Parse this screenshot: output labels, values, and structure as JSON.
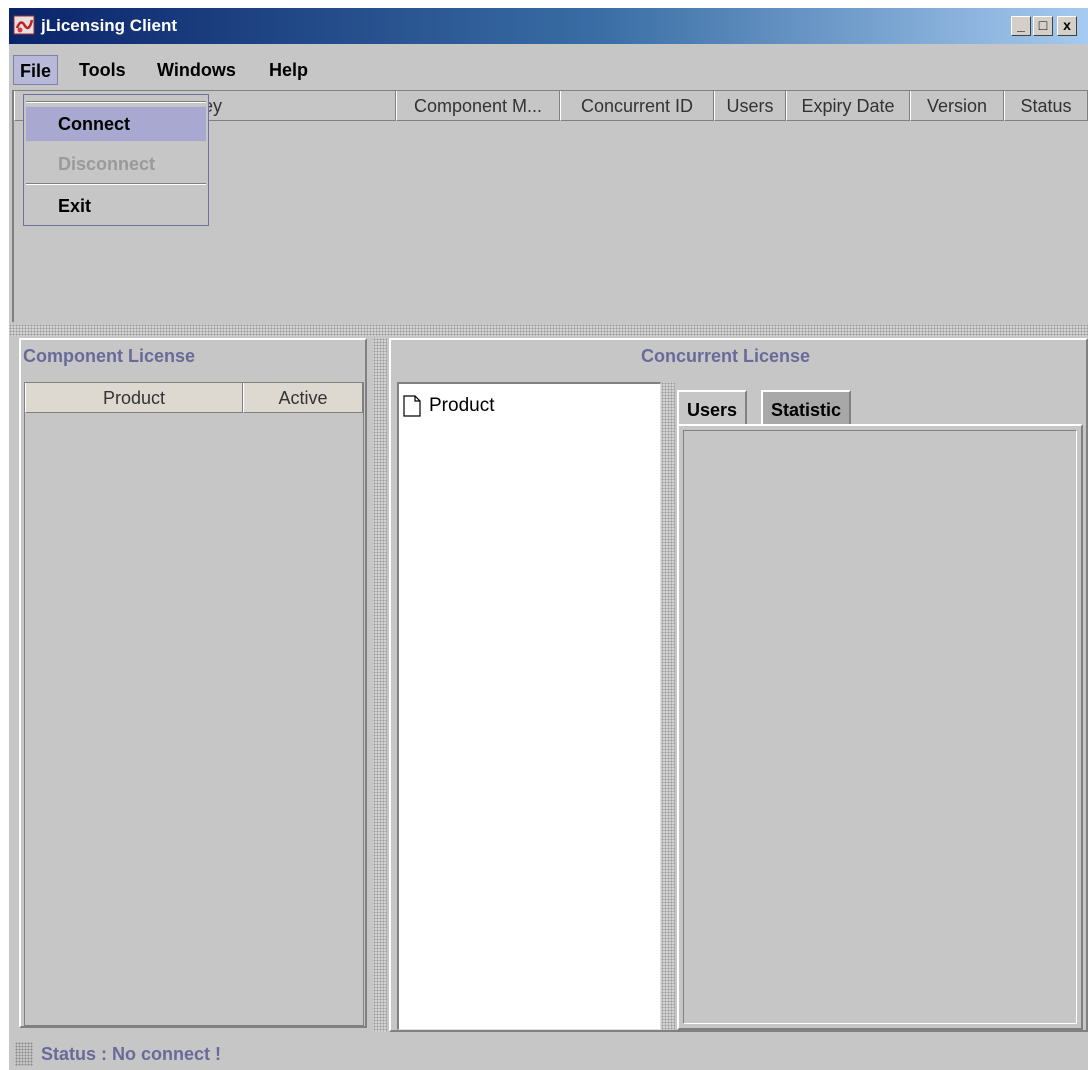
{
  "window": {
    "title": "jLicensing Client",
    "controls": {
      "minimize": "_",
      "maximize": "□",
      "close": "x"
    }
  },
  "menubar": {
    "items": [
      {
        "label": "File",
        "mnemonic": "F",
        "active": true
      },
      {
        "label": "Tools",
        "mnemonic": "T"
      },
      {
        "label": "Windows",
        "mnemonic": "W"
      },
      {
        "label": "Help",
        "mnemonic": "H"
      }
    ]
  },
  "file_menu": {
    "items": [
      {
        "label": "Connect",
        "enabled": true,
        "highlighted": true
      },
      {
        "label": "Disconnect",
        "enabled": false
      },
      {
        "label": "Exit",
        "enabled": true
      }
    ]
  },
  "top_table": {
    "columns": [
      "ey",
      "Component M...",
      "Concurrent ID",
      "Users",
      "Expiry Date",
      "Version",
      "Status"
    ],
    "rows": []
  },
  "component_license": {
    "title": "Component License",
    "columns": [
      "Product",
      "Active"
    ],
    "rows": []
  },
  "concurrent_license": {
    "title": "Concurrent License",
    "tree": {
      "root_label": "Product",
      "root_icon": "document-icon"
    },
    "tabs": [
      {
        "label": "Users",
        "selected": true
      },
      {
        "label": "Statistic",
        "selected": false
      }
    ]
  },
  "status_bar": {
    "text": "Status : No connect !"
  },
  "colors": {
    "titlebar_start": "#0a246a",
    "titlebar_end": "#a6caf0",
    "panel_bg": "#c6c6c6",
    "panel_title": "#6a6a9a",
    "menu_highlight": "#a8a8d0"
  }
}
